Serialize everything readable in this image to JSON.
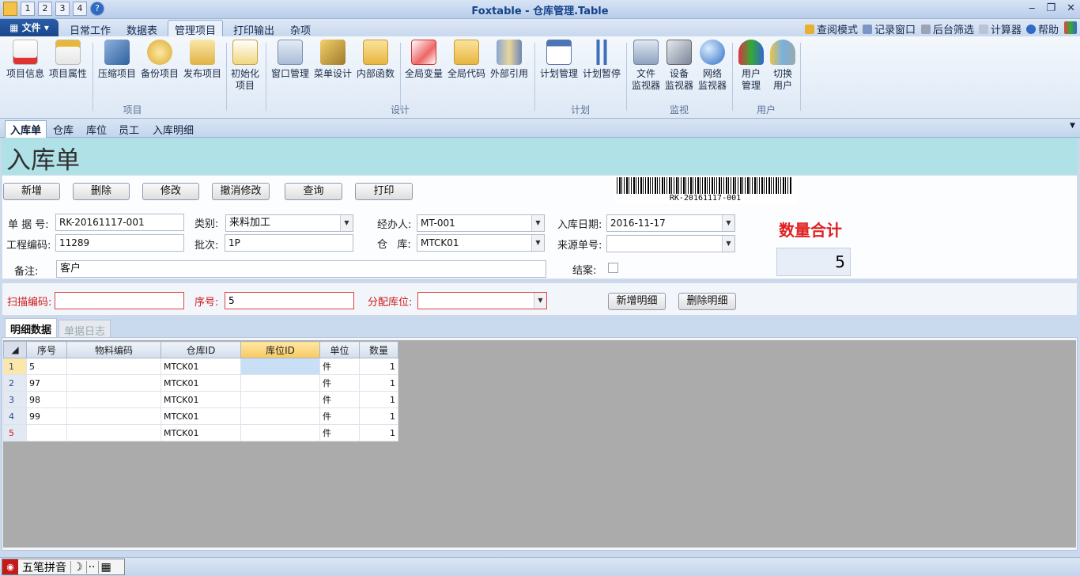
{
  "window": {
    "title": "Foxtable - 仓库管理.Table",
    "qat": [
      "1",
      "2",
      "3",
      "4",
      "?"
    ]
  },
  "menu": {
    "file": "文件",
    "tabs": [
      "日常工作",
      "数据表",
      "管理项目",
      "打印输出",
      "杂项"
    ],
    "active": "管理项目",
    "right": [
      "查阅模式",
      "记录窗口",
      "后台筛选",
      "计算器",
      "帮助"
    ]
  },
  "ribbon": {
    "groups": [
      {
        "name": "项目",
        "buttons": [
          "项目信息",
          "项目属性",
          "压缩项目",
          "备份项目",
          "发布项目",
          "初始化\n项目"
        ]
      },
      {
        "name": "设计",
        "buttons": [
          "窗口管理",
          "菜单设计",
          "内部函数",
          "全局变量",
          "全局代码",
          "外部引用"
        ]
      },
      {
        "name": "计划",
        "buttons": [
          "计划管理",
          "计划暂停"
        ]
      },
      {
        "name": "监视",
        "buttons": [
          "文件\n监视器",
          "设备\n监视器",
          "网络\n监视器"
        ]
      },
      {
        "name": "用户",
        "buttons": [
          "用户\n管理",
          "切换\n用户"
        ]
      }
    ]
  },
  "form_tabs": [
    "入库单",
    "仓库",
    "库位",
    "员工",
    "入库明细"
  ],
  "form": {
    "heading": "入库单",
    "actions": [
      "新增",
      "删除",
      "修改",
      "撤消修改",
      "查询",
      "打印"
    ],
    "barcode": "RK-20161117-001",
    "fields": {
      "doc_no_label": "单 据 号:",
      "doc_no": "RK-20161117-001",
      "type_label": "类别:",
      "type": "来料加工",
      "handler_label": "经办人:",
      "handler": "MT-001",
      "date_label": "入库日期:",
      "date": "2016-11-17",
      "project_label": "工程编码:",
      "project": "11289",
      "batch_label": "批次:",
      "batch": "1P",
      "warehouse_label": "仓   库:",
      "warehouse": "MTCK01",
      "source_label": "来源单号:",
      "source": "",
      "remark_label": "备注:",
      "remark": "客户",
      "closed_label": "结案:"
    },
    "total": {
      "label": "数量合计",
      "value": "5"
    },
    "scan": {
      "code_label": "扫描编码:",
      "code": "",
      "seq_label": "序号:",
      "seq": "5",
      "loc_label": "分配库位:",
      "loc": "",
      "add_btn": "新增明细",
      "del_btn": "删除明细"
    },
    "detail_tabs": [
      "明细数据",
      "单据日志"
    ]
  },
  "grid": {
    "columns": [
      "序号",
      "物料编码",
      "仓库ID",
      "库位ID",
      "单位",
      "数量"
    ],
    "rows": [
      {
        "n": "1",
        "c": [
          "5",
          "",
          "MTCK01",
          "",
          "件",
          "1"
        ]
      },
      {
        "n": "2",
        "c": [
          "97",
          "",
          "MTCK01",
          "",
          "件",
          "1"
        ]
      },
      {
        "n": "3",
        "c": [
          "98",
          "",
          "MTCK01",
          "",
          "件",
          "1"
        ]
      },
      {
        "n": "4",
        "c": [
          "99",
          "",
          "MTCK01",
          "",
          "件",
          "1"
        ]
      },
      {
        "n": "5",
        "c": [
          "",
          "",
          "MTCK01",
          "",
          "件",
          "1"
        ]
      }
    ]
  },
  "statusbar": {
    "ime": "五笔拼音"
  }
}
